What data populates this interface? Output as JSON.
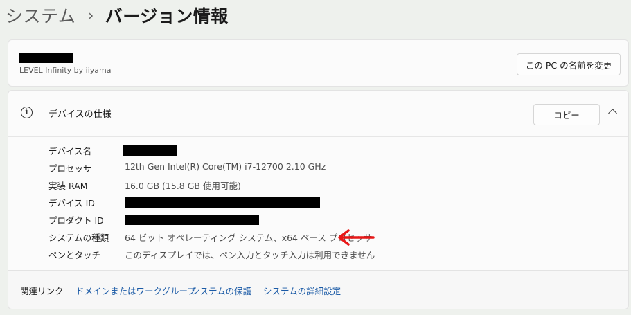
{
  "breadcrumb": {
    "parent": "システム",
    "separator": "›",
    "current": "バージョン情報"
  },
  "pc": {
    "model": "LEVEL Infinity by iiyama",
    "rename_button": "この PC の名前を変更"
  },
  "device_spec": {
    "title": "デバイスの仕様",
    "copy_button": "コピー",
    "rows": [
      {
        "label": "デバイス名",
        "value": ""
      },
      {
        "label": "プロセッサ",
        "value": "12th Gen Intel(R) Core(TM) i7-12700   2.10 GHz"
      },
      {
        "label": "実装 RAM",
        "value": "16.0 GB (15.8 GB 使用可能)"
      },
      {
        "label": "デバイス ID",
        "value": ""
      },
      {
        "label": "プロダクト ID",
        "value": ""
      },
      {
        "label": "システムの種類",
        "value": "64 ビット オペレーティング システム、x64 ベース プロセッサ"
      },
      {
        "label": "ペンとタッチ",
        "value": "このディスプレイでは、ペン入力とタッチ入力は利用できません"
      }
    ]
  },
  "related": {
    "title": "関連リンク",
    "links": [
      "ドメインまたはワークグループ",
      "システムの保護",
      "システムの詳細設定"
    ]
  },
  "colors": {
    "arrow": "#e81818",
    "link": "#1a5aa6",
    "background": "#eef1ed"
  }
}
